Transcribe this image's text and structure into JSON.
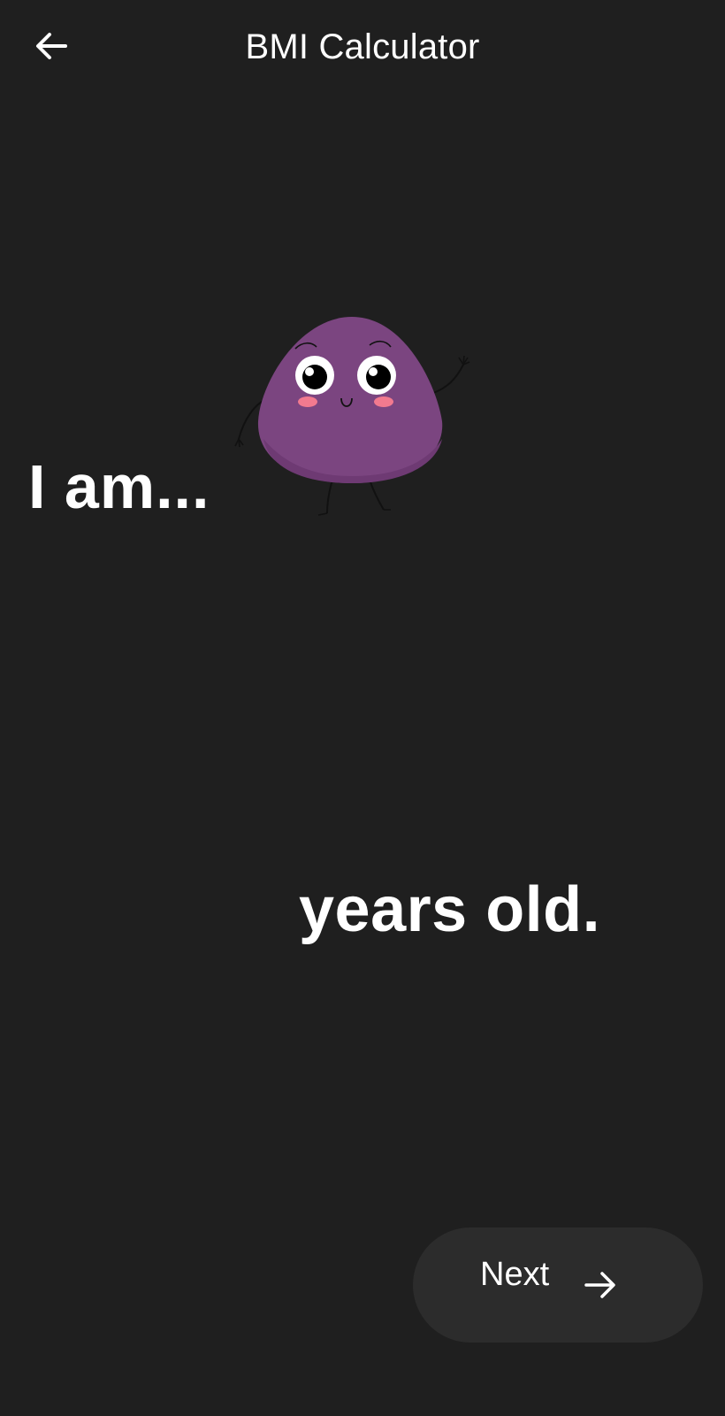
{
  "app_bar": {
    "title": "BMI Calculator",
    "back_icon": "arrow-left-icon"
  },
  "main": {
    "intro_text": "I am...",
    "age_input": {
      "value": "",
      "placeholder": ""
    },
    "suffix_text": "years old.",
    "mascot": "purple-blob-mascot"
  },
  "next_button": {
    "label": "Next",
    "icon": "arrow-right-icon"
  },
  "colors": {
    "background": "#1f1f1f",
    "button_background": "#2c2c2c",
    "mascot_purple": "#7b4580",
    "text": "#ffffff"
  }
}
